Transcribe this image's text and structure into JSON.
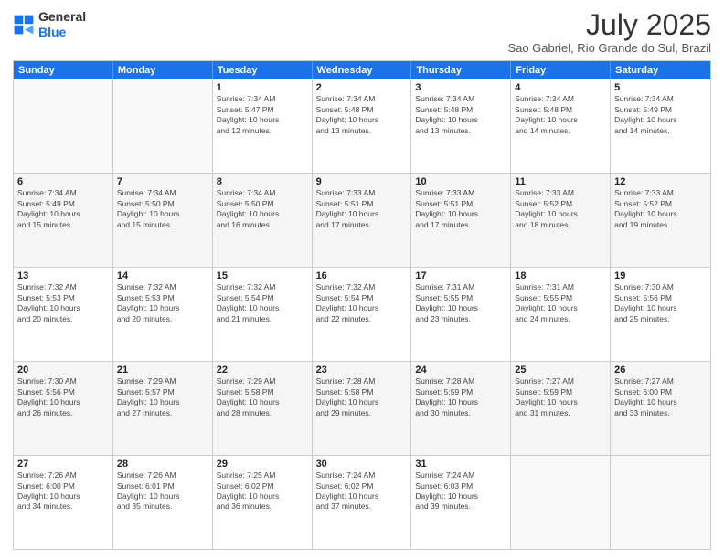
{
  "header": {
    "logo_line1": "General",
    "logo_line2": "Blue",
    "title": "July 2025",
    "subtitle": "Sao Gabriel, Rio Grande do Sul, Brazil"
  },
  "weekdays": [
    "Sunday",
    "Monday",
    "Tuesday",
    "Wednesday",
    "Thursday",
    "Friday",
    "Saturday"
  ],
  "rows": [
    [
      {
        "day": "",
        "info": "",
        "empty": true
      },
      {
        "day": "",
        "info": "",
        "empty": true
      },
      {
        "day": "1",
        "info": "Sunrise: 7:34 AM\nSunset: 5:47 PM\nDaylight: 10 hours\nand 12 minutes."
      },
      {
        "day": "2",
        "info": "Sunrise: 7:34 AM\nSunset: 5:48 PM\nDaylight: 10 hours\nand 13 minutes."
      },
      {
        "day": "3",
        "info": "Sunrise: 7:34 AM\nSunset: 5:48 PM\nDaylight: 10 hours\nand 13 minutes."
      },
      {
        "day": "4",
        "info": "Sunrise: 7:34 AM\nSunset: 5:48 PM\nDaylight: 10 hours\nand 14 minutes."
      },
      {
        "day": "5",
        "info": "Sunrise: 7:34 AM\nSunset: 5:49 PM\nDaylight: 10 hours\nand 14 minutes."
      }
    ],
    [
      {
        "day": "6",
        "info": "Sunrise: 7:34 AM\nSunset: 5:49 PM\nDaylight: 10 hours\nand 15 minutes."
      },
      {
        "day": "7",
        "info": "Sunrise: 7:34 AM\nSunset: 5:50 PM\nDaylight: 10 hours\nand 15 minutes."
      },
      {
        "day": "8",
        "info": "Sunrise: 7:34 AM\nSunset: 5:50 PM\nDaylight: 10 hours\nand 16 minutes."
      },
      {
        "day": "9",
        "info": "Sunrise: 7:33 AM\nSunset: 5:51 PM\nDaylight: 10 hours\nand 17 minutes."
      },
      {
        "day": "10",
        "info": "Sunrise: 7:33 AM\nSunset: 5:51 PM\nDaylight: 10 hours\nand 17 minutes."
      },
      {
        "day": "11",
        "info": "Sunrise: 7:33 AM\nSunset: 5:52 PM\nDaylight: 10 hours\nand 18 minutes."
      },
      {
        "day": "12",
        "info": "Sunrise: 7:33 AM\nSunset: 5:52 PM\nDaylight: 10 hours\nand 19 minutes."
      }
    ],
    [
      {
        "day": "13",
        "info": "Sunrise: 7:32 AM\nSunset: 5:53 PM\nDaylight: 10 hours\nand 20 minutes."
      },
      {
        "day": "14",
        "info": "Sunrise: 7:32 AM\nSunset: 5:53 PM\nDaylight: 10 hours\nand 20 minutes."
      },
      {
        "day": "15",
        "info": "Sunrise: 7:32 AM\nSunset: 5:54 PM\nDaylight: 10 hours\nand 21 minutes."
      },
      {
        "day": "16",
        "info": "Sunrise: 7:32 AM\nSunset: 5:54 PM\nDaylight: 10 hours\nand 22 minutes."
      },
      {
        "day": "17",
        "info": "Sunrise: 7:31 AM\nSunset: 5:55 PM\nDaylight: 10 hours\nand 23 minutes."
      },
      {
        "day": "18",
        "info": "Sunrise: 7:31 AM\nSunset: 5:55 PM\nDaylight: 10 hours\nand 24 minutes."
      },
      {
        "day": "19",
        "info": "Sunrise: 7:30 AM\nSunset: 5:56 PM\nDaylight: 10 hours\nand 25 minutes."
      }
    ],
    [
      {
        "day": "20",
        "info": "Sunrise: 7:30 AM\nSunset: 5:56 PM\nDaylight: 10 hours\nand 26 minutes."
      },
      {
        "day": "21",
        "info": "Sunrise: 7:29 AM\nSunset: 5:57 PM\nDaylight: 10 hours\nand 27 minutes."
      },
      {
        "day": "22",
        "info": "Sunrise: 7:29 AM\nSunset: 5:58 PM\nDaylight: 10 hours\nand 28 minutes."
      },
      {
        "day": "23",
        "info": "Sunrise: 7:28 AM\nSunset: 5:58 PM\nDaylight: 10 hours\nand 29 minutes."
      },
      {
        "day": "24",
        "info": "Sunrise: 7:28 AM\nSunset: 5:59 PM\nDaylight: 10 hours\nand 30 minutes."
      },
      {
        "day": "25",
        "info": "Sunrise: 7:27 AM\nSunset: 5:59 PM\nDaylight: 10 hours\nand 31 minutes."
      },
      {
        "day": "26",
        "info": "Sunrise: 7:27 AM\nSunset: 6:00 PM\nDaylight: 10 hours\nand 33 minutes."
      }
    ],
    [
      {
        "day": "27",
        "info": "Sunrise: 7:26 AM\nSunset: 6:00 PM\nDaylight: 10 hours\nand 34 minutes."
      },
      {
        "day": "28",
        "info": "Sunrise: 7:26 AM\nSunset: 6:01 PM\nDaylight: 10 hours\nand 35 minutes."
      },
      {
        "day": "29",
        "info": "Sunrise: 7:25 AM\nSunset: 6:02 PM\nDaylight: 10 hours\nand 36 minutes."
      },
      {
        "day": "30",
        "info": "Sunrise: 7:24 AM\nSunset: 6:02 PM\nDaylight: 10 hours\nand 37 minutes."
      },
      {
        "day": "31",
        "info": "Sunrise: 7:24 AM\nSunset: 6:03 PM\nDaylight: 10 hours\nand 39 minutes."
      },
      {
        "day": "",
        "info": "",
        "empty": true
      },
      {
        "day": "",
        "info": "",
        "empty": true
      }
    ]
  ]
}
